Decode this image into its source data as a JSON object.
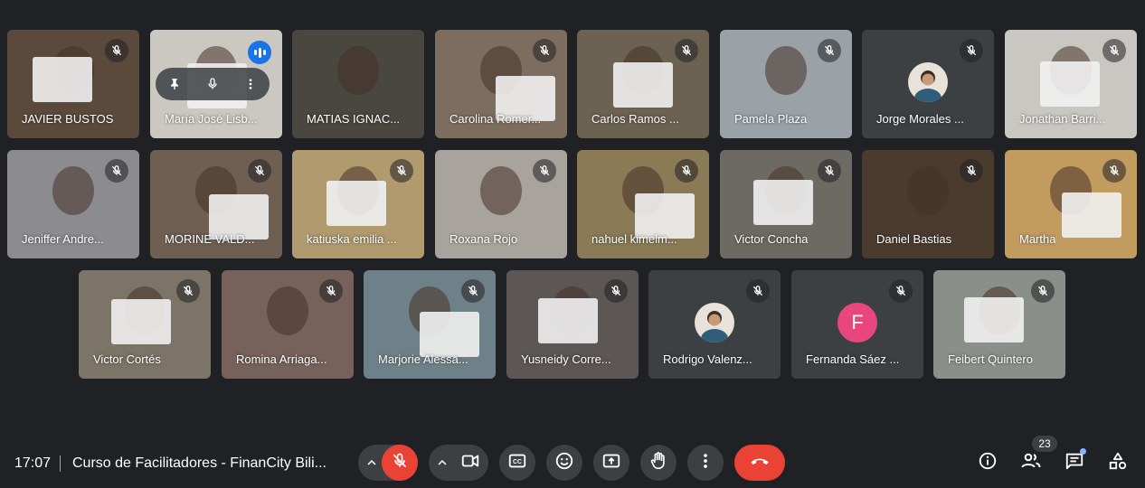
{
  "participants": [
    {
      "name": "JAVIER BUSTOS",
      "bg": "#5b4a3c",
      "muted": true
    },
    {
      "name": "María José Lisb...",
      "bg": "#cbc7c1",
      "muted": false,
      "speaking": true,
      "pinned_hover": true
    },
    {
      "name": "MATIAS IGNAC...",
      "bg": "#4a4640",
      "muted": false
    },
    {
      "name": "Carolina Romer...",
      "bg": "#7d6d5e",
      "muted": true
    },
    {
      "name": "Carlos Ramos ...",
      "bg": "#6c6252",
      "muted": true
    },
    {
      "name": "Pamela Plaza",
      "bg": "#9aa2a7",
      "muted": true
    },
    {
      "name": "Jorge Morales ...",
      "bg": "#3c4043",
      "muted": true,
      "avatar": true
    },
    {
      "name": "Jonathan Barri...",
      "bg": "#c9c7c1",
      "muted": true
    },
    {
      "name": "Jeniffer Andre...",
      "bg": "#8c8c90",
      "muted": true
    },
    {
      "name": "MORINE VALD...",
      "bg": "#6f5f52",
      "muted": true
    },
    {
      "name": "katiuska emilia ...",
      "bg": "#b19a6e",
      "muted": true
    },
    {
      "name": "Roxana Rojo",
      "bg": "#a8a39d",
      "muted": true
    },
    {
      "name": "nahuel kimelm...",
      "bg": "#8a7a56",
      "muted": true
    },
    {
      "name": "Victor Concha",
      "bg": "#6d6a63",
      "muted": true
    },
    {
      "name": "Daniel Bastias",
      "bg": "#4b3b2e",
      "muted": true
    },
    {
      "name": "Martha",
      "bg": "#c29b5e",
      "muted": true
    },
    {
      "name": "Victor Cortés",
      "bg": "#7c7466",
      "muted": true
    },
    {
      "name": "Romina Arriaga...",
      "bg": "#76625a",
      "muted": true
    },
    {
      "name": "Marjorie Alessa...",
      "bg": "#6f8188",
      "muted": true
    },
    {
      "name": "Yusneidy Corre...",
      "bg": "#5c5655",
      "muted": true
    },
    {
      "name": "Rodrigo Valenz...",
      "bg": "#3c4043",
      "muted": true,
      "avatar": true
    },
    {
      "name": "Fernanda Sáez ...",
      "bg": "#3c4043",
      "muted": true,
      "letter": "F"
    },
    {
      "name": "Feibert Quintero",
      "bg": "#8b8f8a",
      "muted": true
    }
  ],
  "bottom": {
    "time": "17:07",
    "meeting_title": "Curso de Facilitadores - FinanCity Bili...",
    "participant_count": "23"
  },
  "icons": {
    "mic_off": "mic-off-icon",
    "camera": "videocam-icon",
    "captions": "closed-caption-icon",
    "reactions": "emoji-icon",
    "present": "present-screen-icon",
    "raise_hand": "hand-icon",
    "more": "more-vert-icon",
    "end_call": "call-end-icon",
    "info": "info-icon",
    "people": "people-icon",
    "chat": "chat-icon",
    "activities": "shapes-icon"
  },
  "colors": {
    "background": "#202124",
    "tile": "#3c4043",
    "danger": "#ea4335",
    "accent": "#8ab4f8",
    "speaking": "#1a73e8",
    "avatar_f": "#e8467c"
  }
}
